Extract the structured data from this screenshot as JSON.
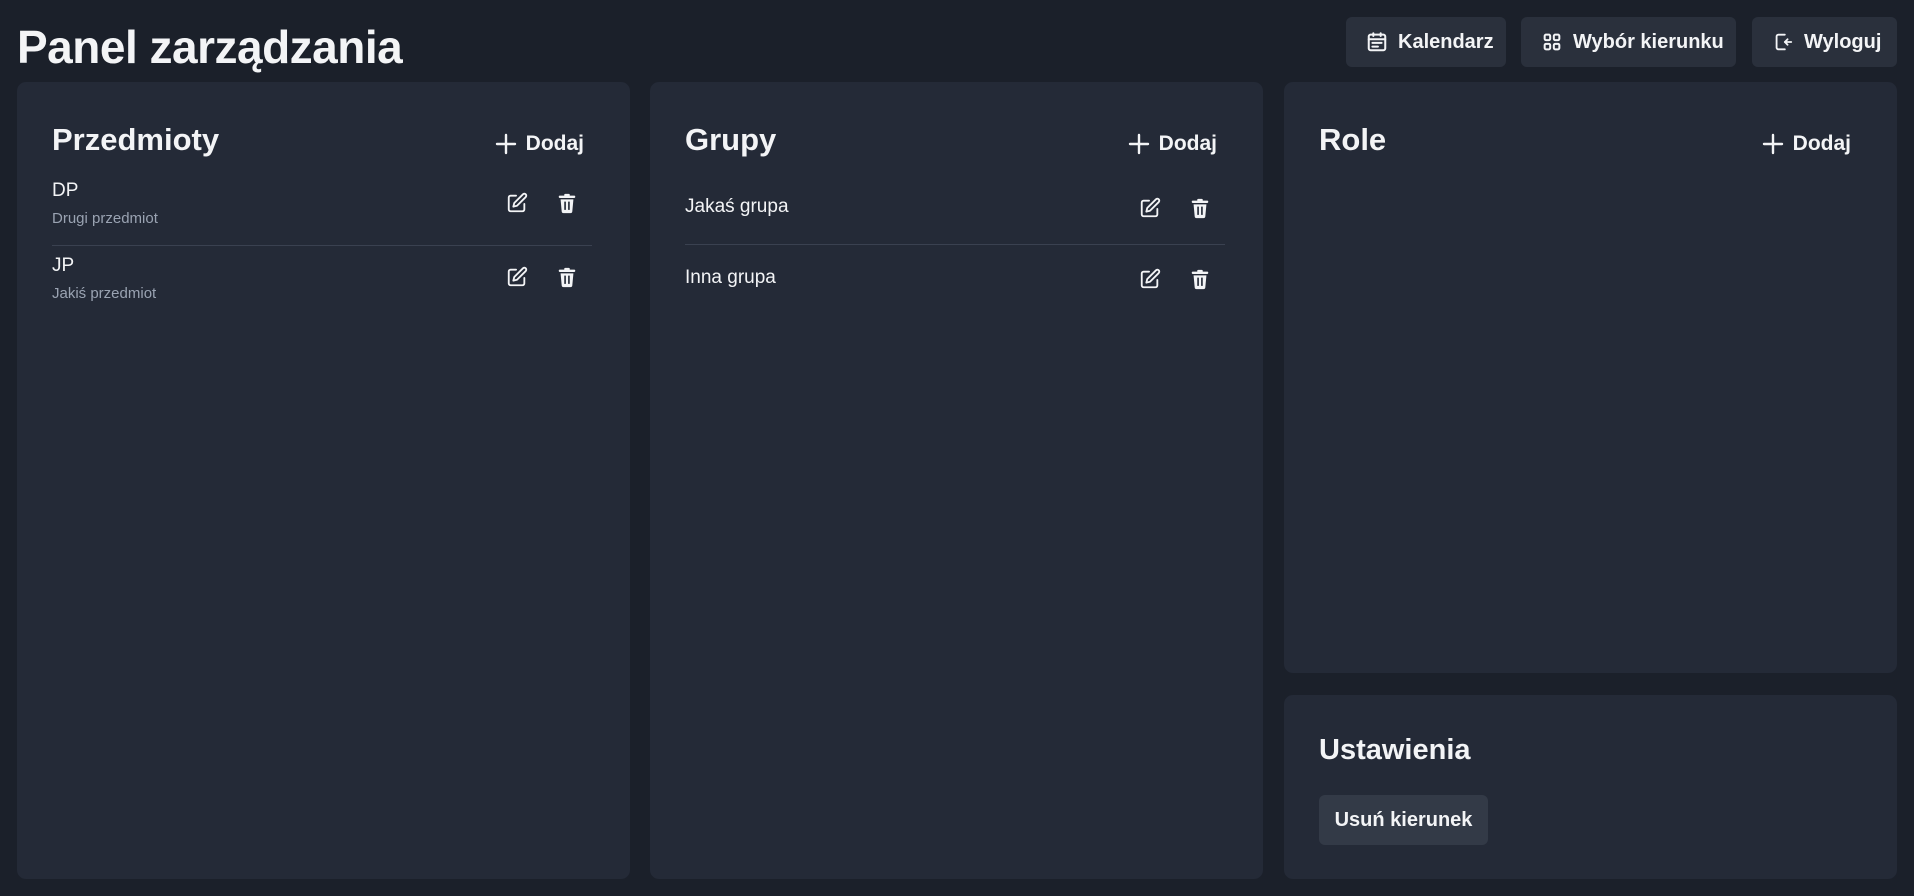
{
  "header": {
    "title": "Panel zarządzania",
    "buttons": {
      "calendar": "Kalendarz",
      "choose_direction": "Wybór kierunku",
      "logout": "Wyloguj"
    }
  },
  "subjects": {
    "title": "Przedmioty",
    "add_label": "Dodaj",
    "items": [
      {
        "code": "DP",
        "name": "Drugi przedmiot"
      },
      {
        "code": "JP",
        "name": "Jakiś przedmiot"
      }
    ]
  },
  "groups": {
    "title": "Grupy",
    "add_label": "Dodaj",
    "items": [
      {
        "name": "Jakaś grupa"
      },
      {
        "name": "Inna grupa"
      }
    ]
  },
  "roles": {
    "title": "Role",
    "add_label": "Dodaj",
    "items": []
  },
  "settings": {
    "title": "Ustawienia",
    "delete_direction_label": "Usuń kierunek"
  },
  "icons": {
    "calendar": "calendar-icon",
    "grid": "grid-icon",
    "logout": "logout-icon",
    "plus": "plus-icon",
    "edit": "edit-icon",
    "trash": "trash-icon"
  },
  "colors": {
    "background": "#1b202a",
    "panel": "#242a37",
    "button": "#2a303c",
    "text": "#f3f4f6",
    "muted_text": "#9aa3b2",
    "divider": "#3a4150"
  }
}
